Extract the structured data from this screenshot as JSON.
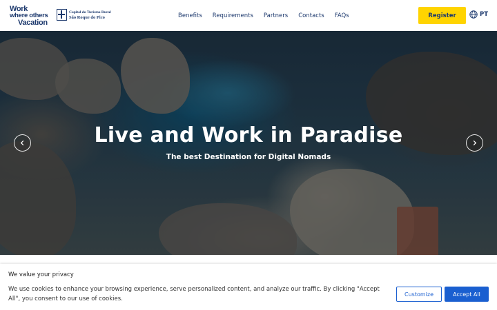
{
  "header": {
    "brand": {
      "line1": "Work",
      "line2": "where others",
      "line3": "Vacation"
    },
    "partner": {
      "line1": "Capital do Turismo Rural",
      "line2": "São Roque do Pico"
    },
    "nav": [
      {
        "label": "Benefits"
      },
      {
        "label": "Requirements"
      },
      {
        "label": "Partners"
      },
      {
        "label": "Contacts"
      },
      {
        "label": "FAQs"
      }
    ],
    "register_label": "Register",
    "language": "PT",
    "language_icon": "globe-icon"
  },
  "hero": {
    "title": "Live and Work in Paradise",
    "subtitle": "The best Destination for Digital Nomads",
    "prev_icon": "chevron-left-icon",
    "next_icon": "chevron-right-icon"
  },
  "cookie": {
    "title": "We value your privacy",
    "text": "We use cookies to enhance your browsing experience, serve personalized content, and analyze our traffic. By clicking \"Accept All\", you consent to our use of cookies.",
    "customize_label": "Customize",
    "accept_label": "Accept All"
  },
  "colors": {
    "brand_navy": "#1e3a6e",
    "register_yellow": "#ffd400",
    "accept_blue": "#1a5fd0"
  }
}
